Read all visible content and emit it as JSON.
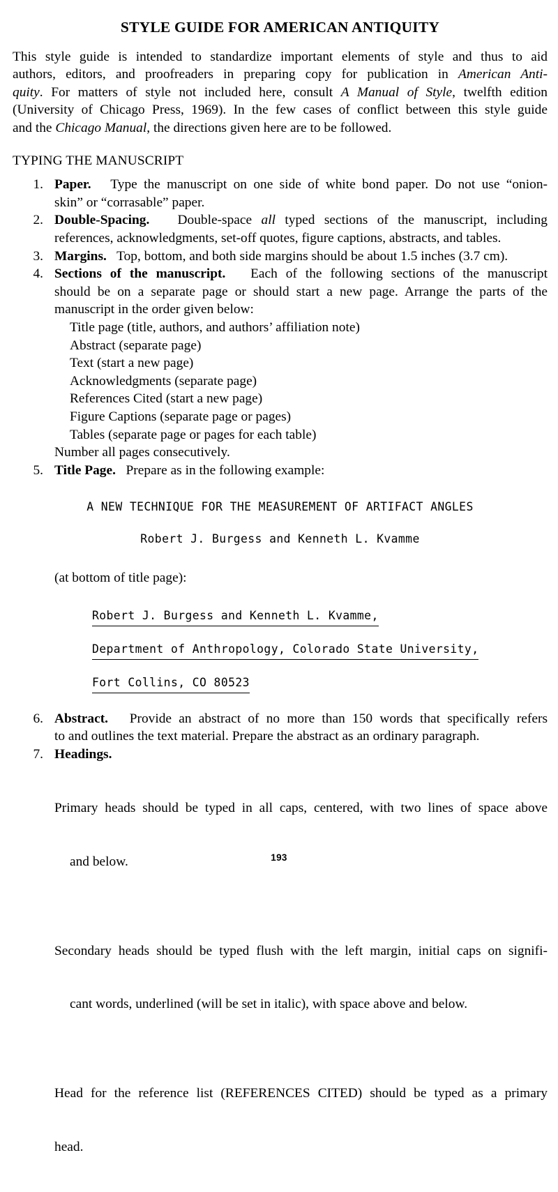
{
  "document": {
    "title": "STYLE GUIDE FOR AMERICAN ANTIQUITY",
    "folio": "193"
  },
  "intro": {
    "line1": "This style guide is intended to standardize important elements of style and thus to aid",
    "line2a": "authors, editors, and proofreaders in preparing copy for publication in ",
    "line2b_italic": "American Anti-",
    "line3a_italic": "quity",
    "line3b": ". For matters of style not included here, consult ",
    "line3c_italic": "A Manual of Style",
    "line3d": ", twelfth edition",
    "line4": "(University of Chicago Press, 1969). In the few cases of conflict between this style guide",
    "line5a": "and the ",
    "line5b_italic": "Chicago Manual",
    "line5c": ", the directions given here are to be followed."
  },
  "section_heading": "TYPING THE MANUSCRIPT",
  "rules": [
    {
      "number": "1.",
      "lead": "Paper.",
      "line1": "Type the manuscript on one side of white bond paper. Do not use “onion-",
      "line2": "skin” or “corrasable” paper."
    },
    {
      "number": "2.",
      "lead": "Double-Spacing.",
      "line1a": "Double-space ",
      "line1b_italic": "all",
      "line1c": " typed sections of the manuscript, including",
      "line2": "references, acknowledgments, set-off quotes, figure captions, abstracts, and tables."
    },
    {
      "number": "3.",
      "lead": "Margins.",
      "line1": "Top, bottom, and both side margins should be about 1.5 inches (3.7 cm)."
    },
    {
      "number": "4.",
      "lead": "Sections of the manuscript.",
      "line1": "Each of the following sections of the manuscript",
      "line2": "should be on a separate page or should start a new page. Arrange the parts of the",
      "line3": "manuscript in the order given below:",
      "subsections": [
        "Title page (title, authors, and authors’ affiliation note)",
        "Abstract (separate page)",
        "Text (start a new page)",
        "Acknowledgments (separate page)",
        "References Cited (start a new page)",
        "Figure Captions (separate page or pages)",
        "Tables (separate page or pages for each table)"
      ],
      "tail": "Number all pages consecutively."
    },
    {
      "number": "5.",
      "lead": "Title Page.",
      "line1": "Prepare as in the following example:"
    },
    {
      "number": "6.",
      "lead": "Abstract.",
      "line1": "Provide an abstract of no more than 150 words that specifically refers",
      "line2": "to and outlines the text material. Prepare the abstract as an ordinary paragraph."
    },
    {
      "number": "7.",
      "lead": "Headings.",
      "paragraphs": [
        {
          "line1": "Primary heads should be typed in all caps, centered, with two lines of space above",
          "line2": "and below."
        },
        {
          "line1": "Secondary heads should be typed flush with the left margin, initial caps on signifi-",
          "line2": "cant words, underlined (will be set in italic), with space above and below."
        },
        {
          "line1": "Head for the reference list (REFERENCES CITED) should be typed as a primary",
          "line2": "head."
        }
      ]
    }
  ],
  "title_page_example": {
    "article_title": "A NEW TECHNIQUE FOR THE MEASUREMENT OF ARTIFACT ANGLES",
    "authors": "Robert J. Burgess and Kenneth L. Kvamme",
    "at_bottom_note": "(at bottom of title page):",
    "address_lines": [
      "Robert J. Burgess and Kenneth L. Kvamme,",
      "Department of Anthropology, Colorado State University,",
      "Fort Collins, CO 80523"
    ]
  }
}
